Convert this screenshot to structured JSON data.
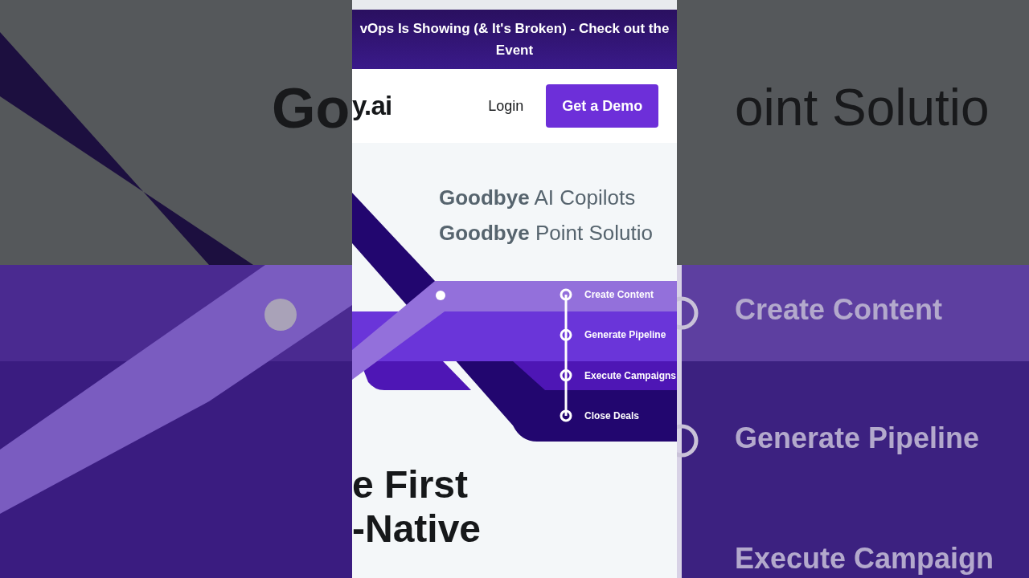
{
  "banner": {
    "text": "vOps Is Showing (& It's Broken) - Check out the",
    "text_2": "Event"
  },
  "nav": {
    "logo": "y.ai",
    "login": "Login",
    "cta": "Get a Demo"
  },
  "hero": {
    "taglines": [
      "**Goodbye** AI Copilots",
      "**Goodbye** Point Solutio"
    ],
    "steps": [
      "Create Content",
      "Generate Pipeline",
      "Execute Campaigns",
      "Close Deals"
    ],
    "headline": [
      "e First",
      "-Native"
    ]
  },
  "backdrop": {
    "left_text": "Go",
    "right_texts": [
      "oint Solutio",
      "Create Content",
      "Generate Pipeline",
      "Execute Campaign"
    ]
  }
}
